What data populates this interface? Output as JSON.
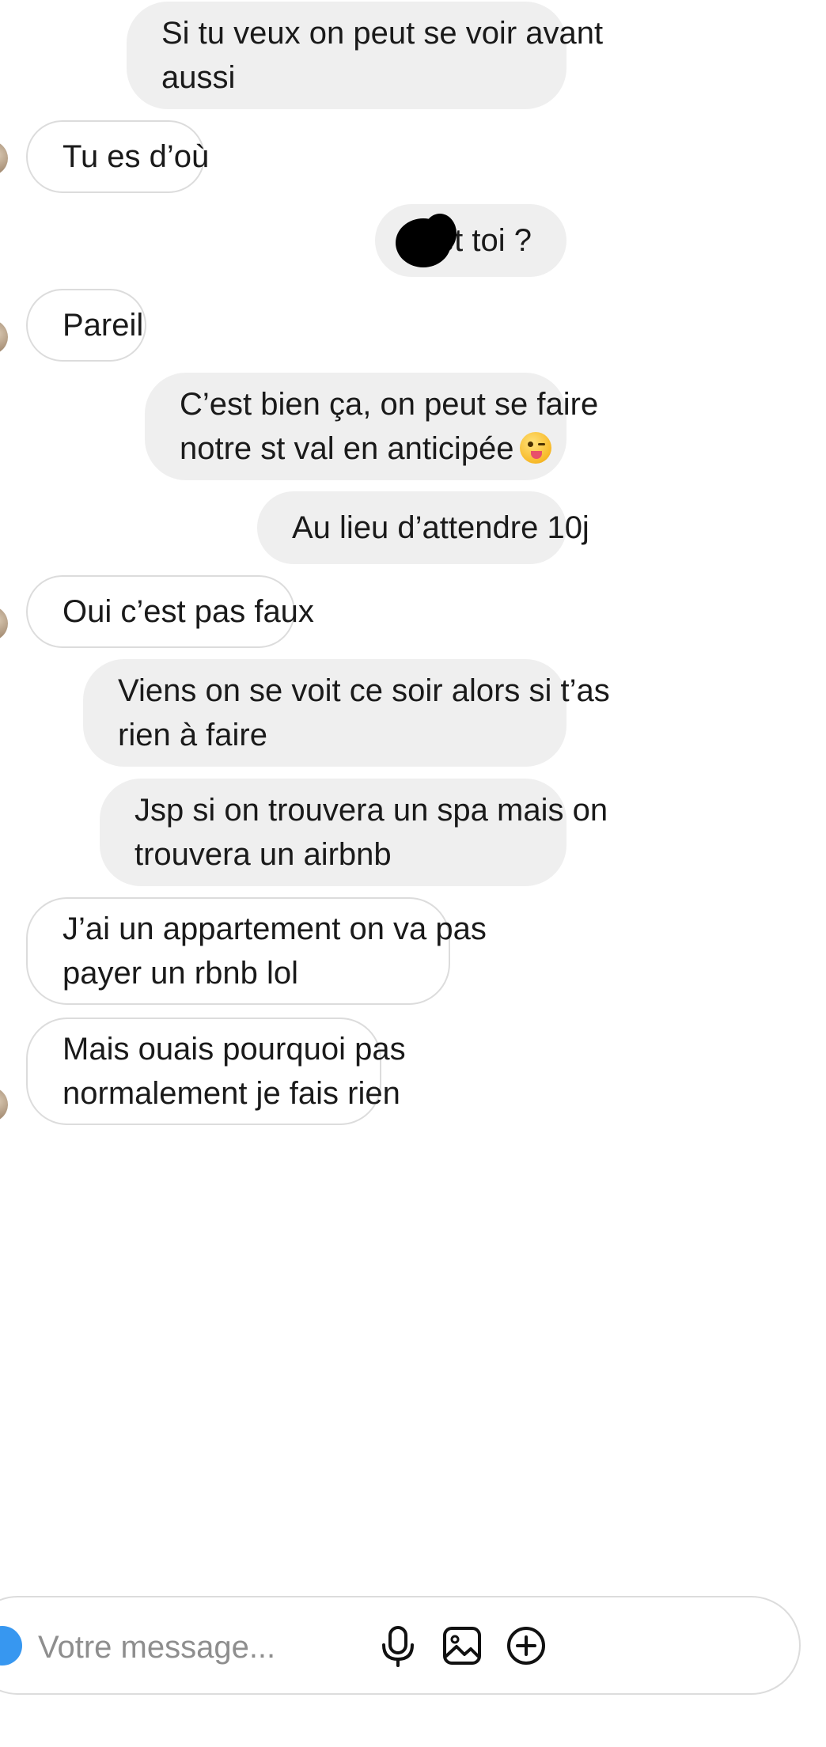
{
  "messages": [
    {
      "side": "sent",
      "lines": [
        "Si tu veux on peut se voir avant",
        "aussi"
      ]
    },
    {
      "side": "received",
      "lines": [
        "Tu es d’où"
      ]
    },
    {
      "side": "sent",
      "lines": [
        "et toi ?"
      ]
    },
    {
      "side": "received",
      "lines": [
        "Pareil"
      ]
    },
    {
      "side": "sent",
      "lines": [
        "C’est bien ça, on peut se faire",
        "notre st val en anticipée"
      ],
      "emoji": "winking-tongue-emoji"
    },
    {
      "side": "sent",
      "lines": [
        "Au lieu d’attendre 10j"
      ]
    },
    {
      "side": "received",
      "lines": [
        "Oui c’est pas faux"
      ]
    },
    {
      "side": "sent",
      "lines": [
        "Viens on se voit ce soir alors si t’as",
        "rien à faire"
      ]
    },
    {
      "side": "sent",
      "lines": [
        "Jsp si on trouvera un spa mais on",
        "trouvera un airbnb"
      ]
    },
    {
      "side": "received",
      "lines": [
        "J’ai un appartement on va pas",
        "payer un rbnb lol"
      ]
    },
    {
      "side": "received",
      "lines": [
        "Mais ouais pourquoi pas",
        "normalement je fais rien"
      ]
    }
  ],
  "composer": {
    "placeholder": "Votre message...",
    "icons": [
      "camera-icon",
      "microphone-icon",
      "gallery-icon",
      "plus-circle-icon"
    ]
  },
  "colors": {
    "sent_bubble": "#efefef",
    "received_border": "#dcdcdc",
    "accent": "#3797f0"
  }
}
